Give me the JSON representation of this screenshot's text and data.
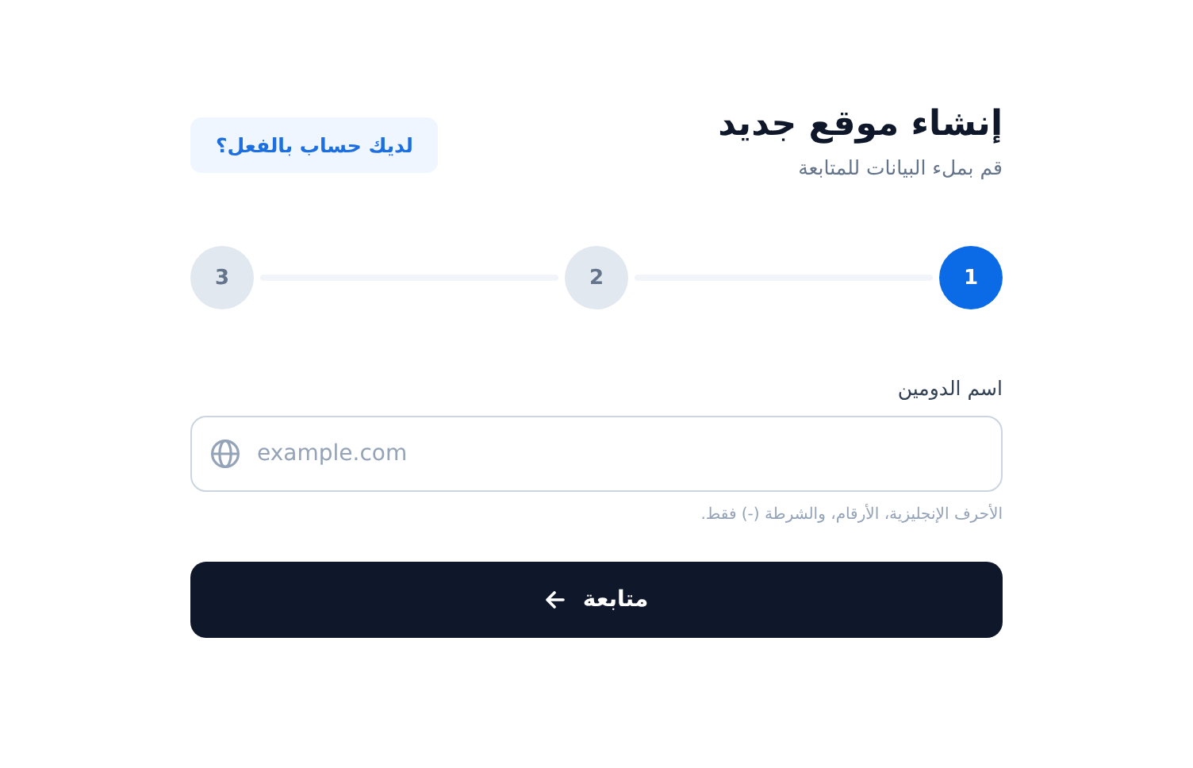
{
  "header": {
    "title": "إنشاء موقع جديد",
    "subtitle": "قم بملء البيانات للمتابعة",
    "login_link": "لديك حساب بالفعل؟"
  },
  "steps": [
    {
      "label": "1",
      "selected": true
    },
    {
      "label": "2",
      "selected": false
    },
    {
      "label": "3",
      "selected": false
    }
  ],
  "domain_field": {
    "label": "اسم الدومين",
    "placeholder": "example.com",
    "hint": "الأحرف الإنجليزية، الأرقام، والشرطة (-) فقط."
  },
  "continue_button": {
    "label": "متابعة"
  }
}
